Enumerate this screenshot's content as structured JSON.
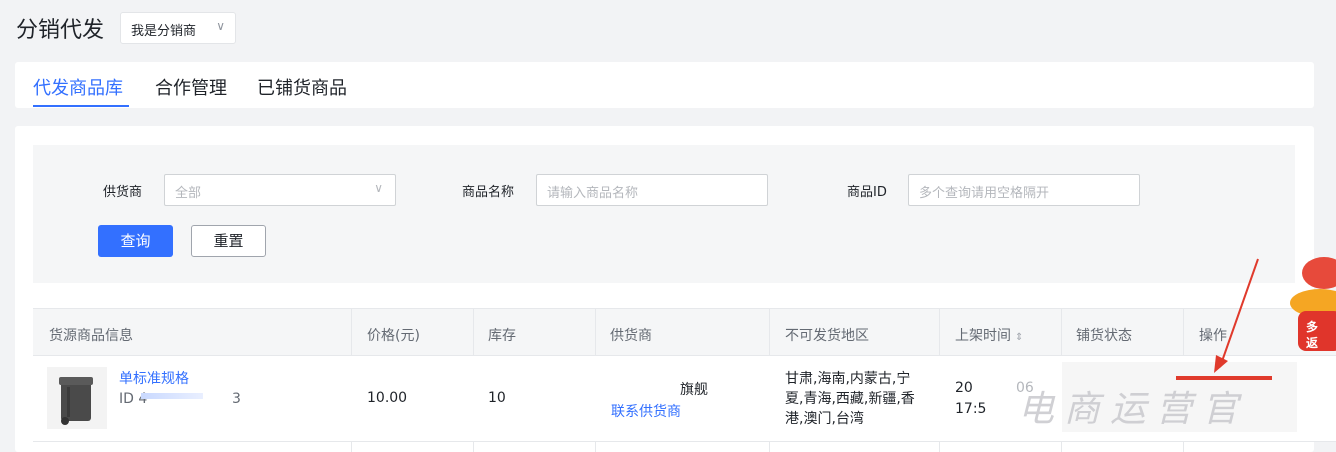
{
  "header": {
    "title": "分销代发",
    "role_select": "我是分销商"
  },
  "tabs": [
    {
      "label": "代发商品库",
      "active": true
    },
    {
      "label": "合作管理",
      "active": false
    },
    {
      "label": "已铺货商品",
      "active": false
    }
  ],
  "filters": {
    "supplier_label": "供货商",
    "supplier_value": "全部",
    "name_label": "商品名称",
    "name_placeholder": "请输入商品名称",
    "id_label": "商品ID",
    "id_placeholder": "多个查询请用空格隔开",
    "query_button": "查询",
    "reset_button": "重置"
  },
  "table": {
    "columns": [
      "货源商品信息",
      "价格(元)",
      "库存",
      "供货商",
      "不可发货地区",
      "上架时间",
      "铺货状态",
      "操作"
    ],
    "rows": [
      {
        "product_name": "单标准规格",
        "product_id_prefix": "ID 4",
        "product_id_suffix": "3",
        "price": "10.00",
        "stock": "10",
        "supplier_name": "旗舰",
        "supplier_contact": "联系供货商",
        "restricted_regions": [
          "甘肃,海南,内蒙古,宁",
          "夏,青海,西藏,新疆,香",
          "港,澳门,台湾"
        ],
        "listed_time_1": "20",
        "listed_time_mid": "06",
        "listed_time_2": "17:5"
      }
    ]
  },
  "watermark": "电商运营官",
  "colors": {
    "primary": "#3370ff",
    "annotation_arrow": "#e03a2c"
  }
}
